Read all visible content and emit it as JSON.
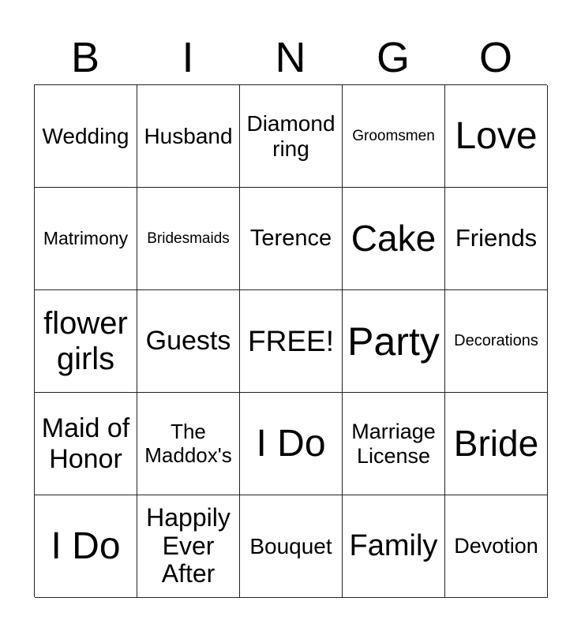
{
  "header": [
    "B",
    "I",
    "N",
    "G",
    "O"
  ],
  "cells": [
    {
      "text": "Wedding",
      "size": 28
    },
    {
      "text": "Husband",
      "size": 28
    },
    {
      "text": "Diamond ring",
      "size": 28
    },
    {
      "text": "Groomsmen",
      "size": 19
    },
    {
      "text": "Love",
      "size": 48
    },
    {
      "text": "Matrimony",
      "size": 23
    },
    {
      "text": "Bridesmaids",
      "size": 19
    },
    {
      "text": "Terence",
      "size": 29
    },
    {
      "text": "Cake",
      "size": 46
    },
    {
      "text": "Friends",
      "size": 31
    },
    {
      "text": "flower girls",
      "size": 40
    },
    {
      "text": "Guests",
      "size": 34
    },
    {
      "text": "FREE!",
      "size": 37
    },
    {
      "text": "Party",
      "size": 50
    },
    {
      "text": "Decorations",
      "size": 20
    },
    {
      "text": "Maid of Honor",
      "size": 34
    },
    {
      "text": "The Maddox's",
      "size": 26
    },
    {
      "text": "I Do",
      "size": 48
    },
    {
      "text": "Marriage License",
      "size": 27
    },
    {
      "text": "Bride",
      "size": 46
    },
    {
      "text": "I Do",
      "size": 48
    },
    {
      "text": "Happily Ever After",
      "size": 32
    },
    {
      "text": "Bouquet",
      "size": 28
    },
    {
      "text": "Family",
      "size": 38
    },
    {
      "text": "Devotion",
      "size": 27
    }
  ]
}
